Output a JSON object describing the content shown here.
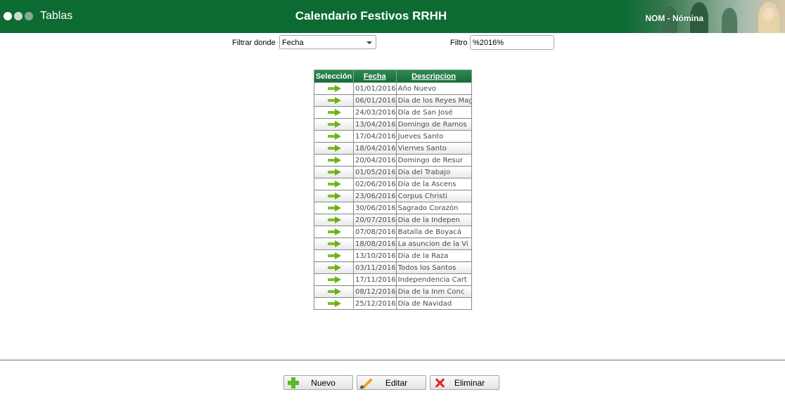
{
  "header": {
    "app_title": "Tablas",
    "page_title": "Calendario Festivos RRHH",
    "user_label": "NOM - Nómina"
  },
  "filter": {
    "where_label": "Filtrar donde",
    "where_value": "Fecha",
    "filter_label": "Filtro",
    "filter_value": "%2016%"
  },
  "table": {
    "columns": [
      "Selección",
      "Fecha",
      "Descripcion"
    ],
    "rows": [
      {
        "fecha": "01/01/2016",
        "descripcion": "Año Nuevo"
      },
      {
        "fecha": "06/01/2016",
        "descripcion": "Dia de los Reyes Mag"
      },
      {
        "fecha": "24/03/2016",
        "descripcion": "Día de San José"
      },
      {
        "fecha": "13/04/2016",
        "descripcion": "Domingo de Ramos"
      },
      {
        "fecha": "17/04/2016",
        "descripcion": "Jueves Santo"
      },
      {
        "fecha": "18/04/2016",
        "descripcion": "Viernes Santo"
      },
      {
        "fecha": "20/04/2016",
        "descripcion": "Domingo de Resur"
      },
      {
        "fecha": "01/05/2016",
        "descripcion": "Día del Trabajo"
      },
      {
        "fecha": "02/06/2016",
        "descripcion": "Día de la Ascens"
      },
      {
        "fecha": "23/06/2016",
        "descripcion": "Corpus Christi"
      },
      {
        "fecha": "30/06/2016",
        "descripcion": "Sagrado Corazón"
      },
      {
        "fecha": "20/07/2016",
        "descripcion": "Dia de la Indepen"
      },
      {
        "fecha": "07/08/2016",
        "descripcion": "Batalla de Boyacá"
      },
      {
        "fecha": "18/08/2016",
        "descripcion": "La asuncion de la Vi"
      },
      {
        "fecha": "13/10/2016",
        "descripcion": "Día de la Raza"
      },
      {
        "fecha": "03/11/2016",
        "descripcion": "Todos los Santos"
      },
      {
        "fecha": "17/11/2016",
        "descripcion": "Independencia Cart"
      },
      {
        "fecha": "08/12/2016",
        "descripcion": "Dia de la Inm Conc"
      },
      {
        "fecha": "25/12/2016",
        "descripcion": "Día de Navidad"
      }
    ]
  },
  "actions": {
    "new_label": "Nuevo",
    "edit_label": "Editar",
    "delete_label": "Eliminar"
  },
  "colors": {
    "header_green": "#0d6b32",
    "arrow_green": "#7dbf2a"
  },
  "icons": {
    "row_select": "arrow-right-icon",
    "new": "plus-icon",
    "edit": "pencil-icon",
    "delete": "x-icon"
  }
}
